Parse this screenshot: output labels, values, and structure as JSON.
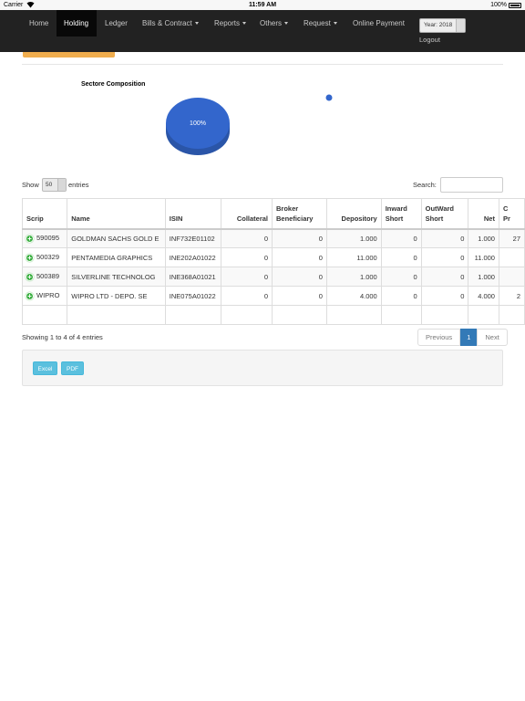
{
  "status_bar": {
    "carrier": "Carrier",
    "time": "11:59 AM",
    "battery": "100%"
  },
  "nav": {
    "items": [
      {
        "label": "Home",
        "active": false,
        "dropdown": false
      },
      {
        "label": "Holding",
        "active": true,
        "dropdown": false
      },
      {
        "label": "Ledger",
        "active": false,
        "dropdown": false
      },
      {
        "label": "Bills & Contract",
        "active": false,
        "dropdown": true
      },
      {
        "label": "Reports",
        "active": false,
        "dropdown": true
      },
      {
        "label": "Others",
        "active": false,
        "dropdown": true
      },
      {
        "label": "Request",
        "active": false,
        "dropdown": true
      },
      {
        "label": "Online Payment",
        "active": false,
        "dropdown": false
      }
    ],
    "year_select": "Year: 2018",
    "logout": "Logout"
  },
  "chart_data": {
    "type": "pie",
    "title": "Sectore Composition",
    "slices": [
      {
        "value": 100,
        "color": "#3366cc"
      }
    ],
    "data_labels": [
      "100%"
    ]
  },
  "table_controls": {
    "show_label": "Show",
    "show_value": "50",
    "entries_label": "entries",
    "search_label": "Search:",
    "search_value": ""
  },
  "table": {
    "headers": [
      "Scrip",
      "Name",
      "ISIN",
      "Collateral",
      "Broker\nBeneficiary",
      "Depository",
      "Inward\nShort",
      "OutWard\nShort",
      "Net",
      "C\nPr"
    ],
    "rows": [
      [
        "590095",
        "GOLDMAN SACHS GOLD E",
        "INF732E01102",
        "0",
        "0",
        "1.000",
        "0",
        "0",
        "1.000",
        "27"
      ],
      [
        "500329",
        "PENTAMEDIA GRAPHICS",
        "INE202A01022",
        "0",
        "0",
        "11.000",
        "0",
        "0",
        "11.000",
        ""
      ],
      [
        "500389",
        "SILVERLINE TECHNOLOG",
        "INE368A01021",
        "0",
        "0",
        "1.000",
        "0",
        "0",
        "1.000",
        ""
      ],
      [
        "WIPRO",
        "WIPRO LTD - DEPO. SE",
        "INE075A01022",
        "0",
        "0",
        "4.000",
        "0",
        "0",
        "4.000",
        "2"
      ]
    ]
  },
  "pagination": {
    "info": "Showing 1 to 4 of 4 entries",
    "previous": "Previous",
    "current": "1",
    "next": "Next"
  },
  "export": {
    "excel": "Excel",
    "pdf": "PDF"
  },
  "colors": {
    "navbar": "#222222",
    "accent_orange": "#f0ad4e",
    "pie_blue": "#3366cc",
    "pager_active": "#337ab7",
    "export_btn": "#5bc0de",
    "plus_green": "#3cb043"
  }
}
